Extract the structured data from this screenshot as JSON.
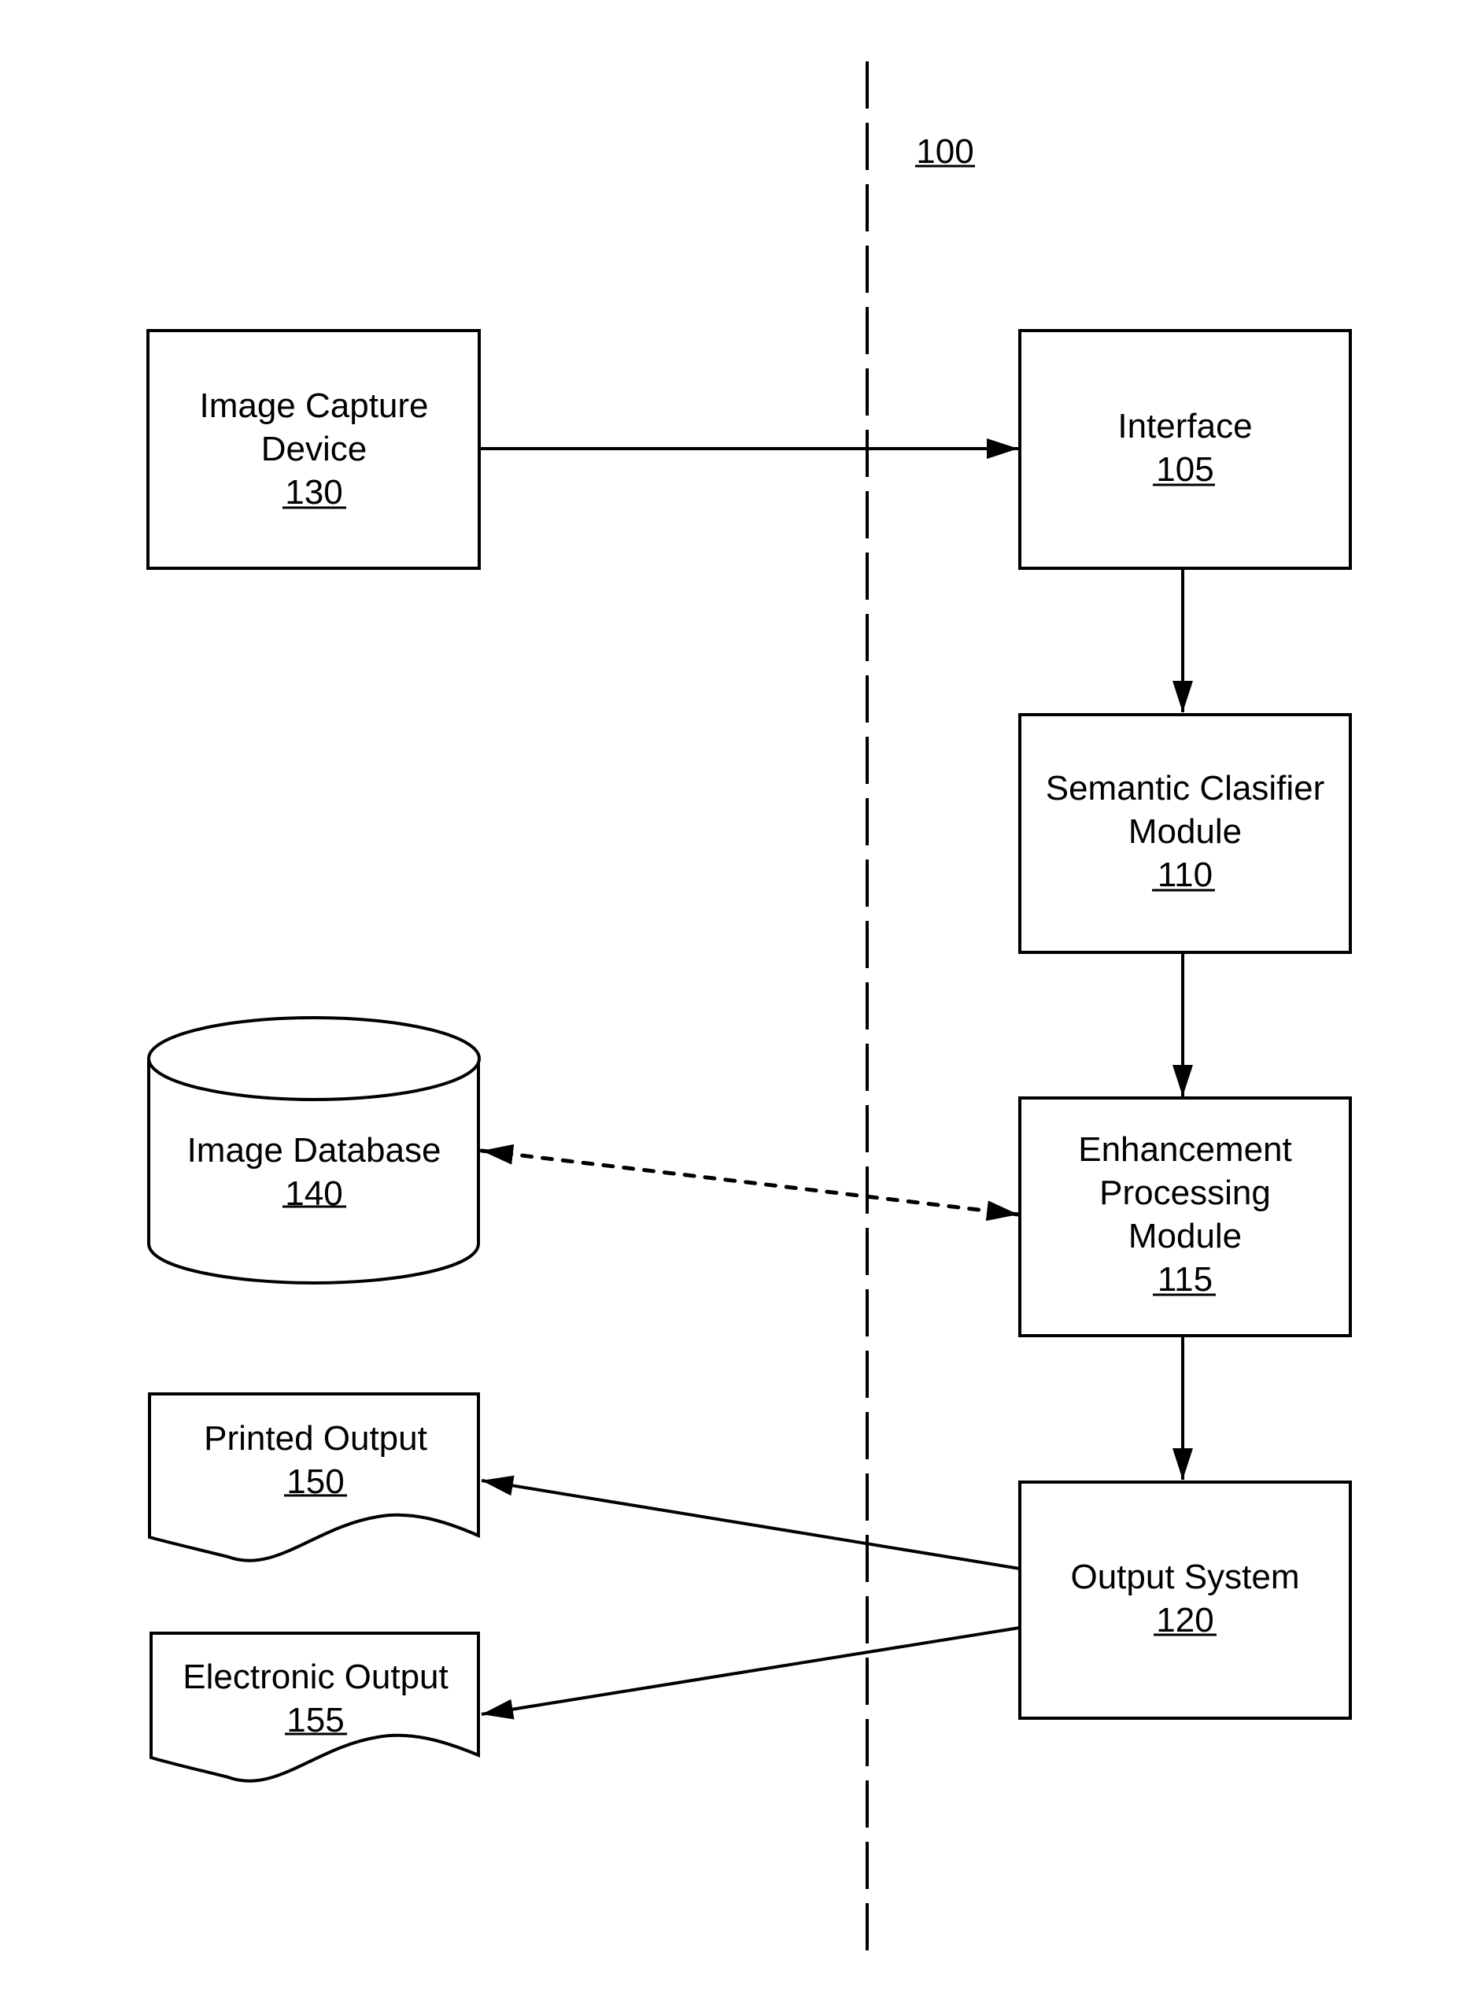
{
  "figure": {
    "reference": "100",
    "background": "#ffffff",
    "ink": "#000000"
  },
  "nodes": {
    "image_capture": {
      "lines": [
        "Image Capture",
        "Device"
      ],
      "ref": "130",
      "shape": "rectangle"
    },
    "interface": {
      "lines": [
        "Interface"
      ],
      "ref": "105",
      "shape": "rectangle"
    },
    "semantic_classifier": {
      "lines": [
        "Semantic Clasifier",
        "Module"
      ],
      "ref": "110",
      "shape": "rectangle"
    },
    "enhancement": {
      "lines": [
        "Enhancement",
        "Processing",
        "Module"
      ],
      "ref": "115",
      "shape": "rectangle"
    },
    "output_system": {
      "lines": [
        "Output System"
      ],
      "ref": "120",
      "shape": "rectangle"
    },
    "image_database": {
      "lines": [
        "Image Database"
      ],
      "ref": "140",
      "shape": "cylinder"
    },
    "printed_output": {
      "lines": [
        "Printed Output"
      ],
      "ref": "150",
      "shape": "document"
    },
    "electronic_output": {
      "lines": [
        "Electronic Output"
      ],
      "ref": "155",
      "shape": "document"
    }
  },
  "edges": [
    {
      "from": "image_capture",
      "to": "interface",
      "style": "solid",
      "direction": "forward"
    },
    {
      "from": "interface",
      "to": "semantic_classifier",
      "style": "solid",
      "direction": "forward"
    },
    {
      "from": "semantic_classifier",
      "to": "enhancement",
      "style": "solid",
      "direction": "forward"
    },
    {
      "from": "image_database",
      "to": "enhancement",
      "style": "dotted",
      "direction": "both"
    },
    {
      "from": "enhancement",
      "to": "output_system",
      "style": "solid",
      "direction": "forward"
    },
    {
      "from": "output_system",
      "to": "printed_output",
      "style": "solid",
      "direction": "forward"
    },
    {
      "from": "output_system",
      "to": "electronic_output",
      "style": "solid",
      "direction": "forward"
    }
  ],
  "divider": {
    "style": "dashed",
    "orientation": "vertical"
  }
}
